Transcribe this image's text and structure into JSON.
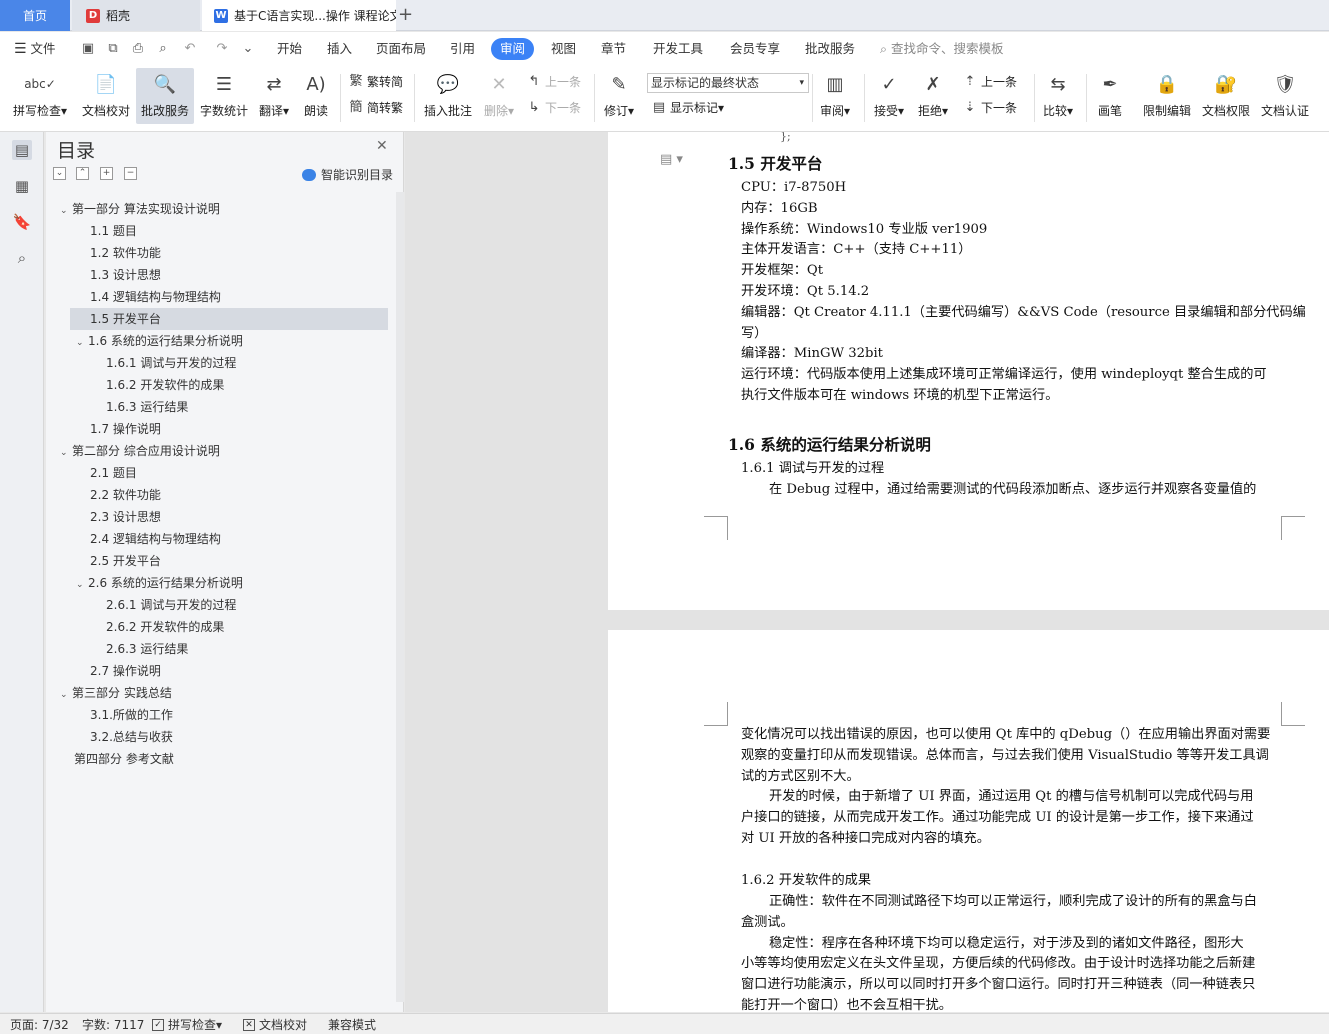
{
  "tabs": {
    "home": "首页",
    "docer": "稻壳",
    "doc": "基于C语言实现...操作 课程论文",
    "add": "+"
  },
  "menu": {
    "file": "文件",
    "items": [
      "开始",
      "插入",
      "页面布局",
      "引用",
      "审阅",
      "视图",
      "章节",
      "开发工具",
      "会员专享",
      "批改服务"
    ],
    "search_placeholder": "查找命令、搜索模板"
  },
  "ribbon": {
    "spellcheck": "拼写检查",
    "doc_proof": "文档校对",
    "pigai": "批改服务",
    "wordcount": "字数统计",
    "translate": "翻译",
    "read": "朗读",
    "trad_to_simp": "繁转简",
    "simp_to_trad": "简转繁",
    "insert_comment": "插入批注",
    "delete": "删除",
    "prev": "上一条",
    "next": "下一条",
    "revise": "修订",
    "markup_select": "显示标记的最终状态",
    "show_markup": "显示标记",
    "review": "审阅",
    "accept": "接受",
    "reject": "拒绝",
    "prev2": "上一条",
    "next2": "下一条",
    "compare": "比较",
    "pen": "画笔",
    "restrict_edit": "限制编辑",
    "doc_permission": "文档权限",
    "doc_cert": "文档认证"
  },
  "toc": {
    "title": "目录",
    "smart_label": "智能识别目录",
    "items": [
      {
        "label": "第一部分  算法实现设计说明",
        "level": 0,
        "arrow": "v"
      },
      {
        "label": "1.1 题目",
        "level": 1
      },
      {
        "label": "1.2 软件功能",
        "level": 1
      },
      {
        "label": "1.3 设计思想",
        "level": 1
      },
      {
        "label": "1.4 逻辑结构与物理结构",
        "level": 1
      },
      {
        "label": "1.5 开发平台",
        "level": 1,
        "selected": true
      },
      {
        "label": "1.6 系统的运行结果分析说明",
        "level": 1,
        "arrow": "v"
      },
      {
        "label": "1.6.1  调试与开发的过程",
        "level": 2
      },
      {
        "label": "1.6.2  开发软件的成果",
        "level": 2
      },
      {
        "label": "1.6.3  运行结果",
        "level": 2
      },
      {
        "label": "1.7 操作说明",
        "level": 1
      },
      {
        "label": "第二部分  综合应用设计说明",
        "level": 0,
        "arrow": "v"
      },
      {
        "label": "2.1 题目",
        "level": 1
      },
      {
        "label": "2.2 软件功能",
        "level": 1
      },
      {
        "label": "2.3 设计思想",
        "level": 1
      },
      {
        "label": "2.4 逻辑结构与物理结构",
        "level": 1
      },
      {
        "label": "2.5 开发平台",
        "level": 1
      },
      {
        "label": "2.6 系统的运行结果分析说明",
        "level": 1,
        "arrow": "v"
      },
      {
        "label": "2.6.1  调试与开发的过程",
        "level": 2
      },
      {
        "label": "2.6.2  开发软件的成果",
        "level": 2
      },
      {
        "label": "2.6.3  运行结果",
        "level": 2
      },
      {
        "label": "2.7 操作说明",
        "level": 1
      },
      {
        "label": "第三部分  实践总结",
        "level": 0,
        "arrow": "v"
      },
      {
        "label": "3.1.所做的工作",
        "level": 1
      },
      {
        "label": "3.2.总结与收获",
        "level": 1
      },
      {
        "label": "第四部分  参考文献",
        "level": 0
      }
    ]
  },
  "doc": {
    "brace": "};",
    "h15": "1.5 开发平台",
    "p1": [
      "CPU：i7-8750H",
      "内存：16GB",
      "操作系统：Windows10 专业版  ver1909",
      "主体开发语言：C++（支持 C++11）",
      "开发框架：Qt",
      "开发环境：Qt 5.14.2",
      "编辑器：Qt Creator 4.11.1（主要代码编写）&&VS Code（resource 目录编辑和部分代码编",
      "写）",
      "编译器：MinGW 32bit",
      "运行环境：代码版本使用上述集成环境可正常编译运行，使用 windeployqt 整合生成的可",
      "执行文件版本可在 windows 环境的机型下正常运行。"
    ],
    "h16": "1.6 系统的运行结果分析说明",
    "h161": "1.6.1  调试与开发的过程",
    "p161a": "在 Debug 过程中，通过给需要测试的代码段添加断点、逐步运行并观察各变量值的",
    "p2": [
      "变化情况可以找出错误的原因，也可以使用 Qt 库中的 qDebug（）在应用输出界面对需要",
      "观察的变量打印从而发现错误。总体而言，与过去我们使用 VisualStudio 等等开发工具调",
      "试的方式区别不大。",
      "开发的时候，由于新增了 UI 界面，通过运用 Qt 的槽与信号机制可以完成代码与用",
      "户接口的链接，从而完成开发工作。通过功能完成 UI 的设计是第一步工作，接下来通过",
      "对 UI 开放的各种接口完成对内容的填充。"
    ],
    "h162": "1.6.2  开发软件的成果",
    "p3": [
      "正确性：软件在不同测试路径下均可以正常运行，顺利完成了设计的所有的黑盒与白",
      "盒测试。",
      "稳定性：程序在各种环境下均可以稳定运行，对于涉及到的诸如文件路径，图形大",
      "小等等均使用宏定义在头文件呈现，方便后续的代码修改。由于设计时选择功能之后新建",
      "窗口进行功能演示，所以可以同时打开多个窗口运行。同时打开三种链表（同一种链表只",
      "能打开一个窗口）也不会互相干扰。"
    ]
  },
  "status": {
    "page": "页面: 7/32",
    "words": "字数: 7117",
    "spell": "拼写检查",
    "proof": "文档校对",
    "compat": "兼容模式"
  }
}
